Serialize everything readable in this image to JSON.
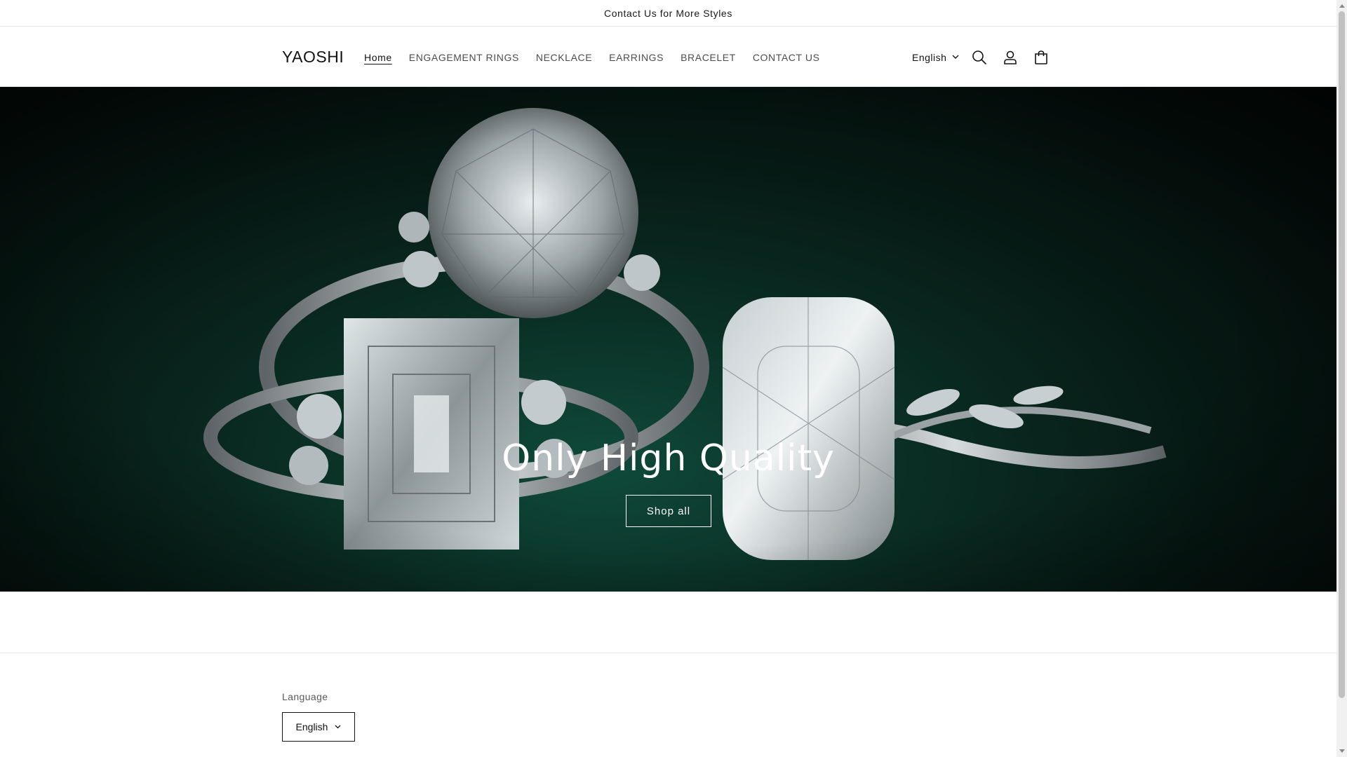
{
  "announcement": {
    "text": "Contact Us for More Styles"
  },
  "header": {
    "logo": "YAOSHI",
    "nav": [
      {
        "label": "Home",
        "active": true
      },
      {
        "label": "ENGAGEMENT RINGS",
        "active": false
      },
      {
        "label": "NECKLACE",
        "active": false
      },
      {
        "label": "EARRINGS",
        "active": false
      },
      {
        "label": "BRACELET",
        "active": false
      },
      {
        "label": "CONTACT US",
        "active": false
      }
    ],
    "language": "English",
    "icons": [
      "search-icon",
      "account-icon",
      "cart-icon",
      "chevron-down-icon"
    ]
  },
  "hero": {
    "title": "Only High Quality",
    "button_label": "Shop all",
    "image_alt_icon": "rings-image"
  },
  "footer": {
    "language_label": "Language",
    "language_value": "English"
  },
  "colors": {
    "text": "#121212",
    "hero_bg": "#061813",
    "hero_accent": "#0f4a3a",
    "white": "#ffffff",
    "border": "#e6e6e6"
  }
}
